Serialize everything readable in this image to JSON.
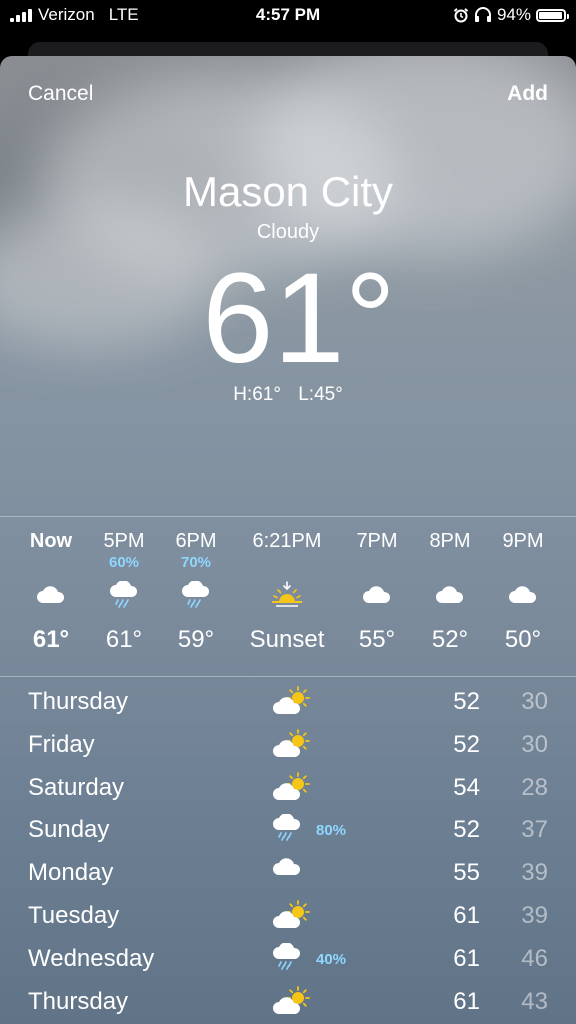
{
  "status": {
    "carrier": "Verizon",
    "network": "LTE",
    "time": "4:57 PM",
    "battery": "94%",
    "battery_level": 0.94
  },
  "nav": {
    "cancel": "Cancel",
    "add": "Add"
  },
  "current": {
    "city": "Mason City",
    "condition": "Cloudy",
    "temperature": "61°",
    "high": "H:61°",
    "low": "L:45°"
  },
  "hourly": [
    {
      "time": "Now",
      "precip": "",
      "icon": "cloud-icon",
      "temp": "61°",
      "bold": true
    },
    {
      "time": "5PM",
      "precip": "60%",
      "icon": "cloud-rain-icon",
      "temp": "61°"
    },
    {
      "time": "6PM",
      "precip": "70%",
      "icon": "cloud-rain-icon",
      "temp": "59°"
    },
    {
      "time": "6:21PM",
      "precip": "",
      "icon": "sunset-icon",
      "temp": "Sunset"
    },
    {
      "time": "7PM",
      "precip": "",
      "icon": "cloud-icon",
      "temp": "55°"
    },
    {
      "time": "8PM",
      "precip": "",
      "icon": "cloud-icon",
      "temp": "52°"
    },
    {
      "time": "9PM",
      "precip": "",
      "icon": "cloud-icon",
      "temp": "50°"
    }
  ],
  "daily": [
    {
      "day": "Thursday",
      "icon": "partly-sunny-icon",
      "precip": "",
      "high": "52",
      "low": "30"
    },
    {
      "day": "Friday",
      "icon": "partly-sunny-icon",
      "precip": "",
      "high": "52",
      "low": "30"
    },
    {
      "day": "Saturday",
      "icon": "partly-sunny-icon",
      "precip": "",
      "high": "54",
      "low": "28"
    },
    {
      "day": "Sunday",
      "icon": "cloud-rain-icon",
      "precip": "80%",
      "high": "52",
      "low": "37"
    },
    {
      "day": "Monday",
      "icon": "cloud-icon",
      "precip": "",
      "high": "55",
      "low": "39"
    },
    {
      "day": "Tuesday",
      "icon": "partly-sunny-icon",
      "precip": "",
      "high": "61",
      "low": "39"
    },
    {
      "day": "Wednesday",
      "icon": "cloud-rain-icon",
      "precip": "40%",
      "high": "61",
      "low": "46"
    },
    {
      "day": "Thursday",
      "icon": "partly-sunny-icon",
      "precip": "",
      "high": "61",
      "low": "43"
    }
  ],
  "colors": {
    "precip": "#8fd6ff",
    "sun": "#f5c518"
  }
}
